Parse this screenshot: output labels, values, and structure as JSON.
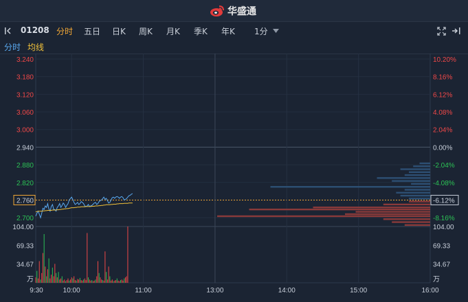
{
  "header": {
    "brand_name": "华盛通"
  },
  "toolbar": {
    "stock_code": "01208",
    "tabs": [
      {
        "label": "分时",
        "active": true
      },
      {
        "label": "五日",
        "active": false
      },
      {
        "label": "日K",
        "active": false
      },
      {
        "label": "周K",
        "active": false
      },
      {
        "label": "月K",
        "active": false
      },
      {
        "label": "季K",
        "active": false
      },
      {
        "label": "年K",
        "active": false
      }
    ],
    "interval_label": "1分",
    "icons": [
      "collapse-left-icon",
      "chevron-down-icon",
      "fullscreen-icon",
      "expand-right-icon"
    ]
  },
  "legend": {
    "timeshare_label": "分时",
    "avg_label": "均线"
  },
  "colors": {
    "background": "#1b2433",
    "up": "#f04848",
    "down": "#2cc255",
    "price_line": "#5aa9f0",
    "avg_line": "#f2c23a",
    "active_tab": "#f2a735",
    "bid_bars": "#8a3a3a",
    "ask_bars": "#2d4f73"
  },
  "chart_data": {
    "type": "line",
    "title": "",
    "y_ticks": [
      {
        "price": "3.240",
        "pct": "10.20%",
        "dir": "up"
      },
      {
        "price": "3.180",
        "pct": "8.16%",
        "dir": "up"
      },
      {
        "price": "3.120",
        "pct": "6.12%",
        "dir": "up"
      },
      {
        "price": "3.060",
        "pct": "4.08%",
        "dir": "up"
      },
      {
        "price": "3.000",
        "pct": "2.04%",
        "dir": "up"
      },
      {
        "price": "2.940",
        "pct": "0.00%",
        "dir": "flat"
      },
      {
        "price": "2.880",
        "pct": "-2.04%",
        "dir": "down"
      },
      {
        "price": "2.820",
        "pct": "-4.08%",
        "dir": "down"
      },
      {
        "price": "2.760",
        "pct": "-6.12%",
        "dir": "current"
      },
      {
        "price": "2.700",
        "pct": "-8.16%",
        "dir": "down"
      }
    ],
    "ylim": [
      2.67,
      3.24
    ],
    "prev_close": 2.94,
    "current_price": 2.76,
    "current_price_label": "2.760",
    "current_pct_label": "-6.12%",
    "x_ticks": [
      "9:30",
      "10:00",
      "11:00",
      "13:00",
      "14:00",
      "15:00",
      "16:00"
    ],
    "session_minutes": 330,
    "series": [
      {
        "name": "分时",
        "values": [
          2.705,
          2.715,
          2.722,
          2.712,
          2.7,
          2.715,
          2.732,
          2.728,
          2.74,
          2.735,
          2.748,
          2.73,
          2.722,
          2.738,
          2.745,
          2.728,
          2.728,
          2.722,
          2.735,
          2.74,
          2.748,
          2.735,
          2.742,
          2.75,
          2.745,
          2.735,
          2.742,
          2.748,
          2.76,
          2.765,
          2.77,
          2.762,
          2.752,
          2.745,
          2.748,
          2.752,
          2.745,
          2.748,
          2.755,
          2.752,
          2.748,
          2.74,
          2.738,
          2.74,
          2.745,
          2.738,
          2.74,
          2.742,
          2.746,
          2.75,
          2.752,
          2.745,
          2.748,
          2.755,
          2.758,
          2.76,
          2.765,
          2.77,
          2.762,
          2.766,
          2.758,
          2.75,
          2.752,
          2.76,
          2.768,
          2.77,
          2.766,
          2.77,
          2.772,
          2.77,
          2.766,
          2.77,
          2.772,
          2.768,
          2.76,
          2.762,
          2.765,
          2.77,
          2.775,
          2.776,
          2.78,
          2.782
        ]
      },
      {
        "name": "均线",
        "values": [
          2.72,
          2.721,
          2.722,
          2.722,
          2.722,
          2.722,
          2.723,
          2.723,
          2.724,
          2.724,
          2.725,
          2.725,
          2.725,
          2.725,
          2.726,
          2.726,
          2.726,
          2.726,
          2.727,
          2.727,
          2.728,
          2.728,
          2.729,
          2.729,
          2.73,
          2.73,
          2.731,
          2.731,
          2.732,
          2.733,
          2.734,
          2.734,
          2.734,
          2.735,
          2.735,
          2.736,
          2.736,
          2.736,
          2.737,
          2.737,
          2.737,
          2.737,
          2.738,
          2.738,
          2.738,
          2.738,
          2.738,
          2.739,
          2.739,
          2.739,
          2.74,
          2.74,
          2.74,
          2.741,
          2.741,
          2.742,
          2.742,
          2.743,
          2.743,
          2.744,
          2.744,
          2.744,
          2.744,
          2.745,
          2.745,
          2.746,
          2.746,
          2.746,
          2.747,
          2.747,
          2.748,
          2.748,
          2.748,
          2.748,
          2.749,
          2.749,
          2.749,
          2.749,
          2.75,
          2.75,
          2.75,
          2.75
        ]
      }
    ],
    "volume": {
      "ticks": [
        "104.00",
        "69.33",
        "34.67"
      ],
      "unit": "万",
      "max": 104,
      "bars": [
        {
          "v": 10,
          "up": true
        },
        {
          "v": 22,
          "up": false
        },
        {
          "v": 8,
          "up": true
        },
        {
          "v": 40,
          "up": true
        },
        {
          "v": 6,
          "up": false
        },
        {
          "v": 18,
          "up": true
        },
        {
          "v": 55,
          "up": true
        },
        {
          "v": 90,
          "up": false
        },
        {
          "v": 30,
          "up": true
        },
        {
          "v": 12,
          "up": false
        },
        {
          "v": 25,
          "up": true
        },
        {
          "v": 45,
          "up": false
        },
        {
          "v": 8,
          "up": true
        },
        {
          "v": 15,
          "up": true
        },
        {
          "v": 28,
          "up": false
        },
        {
          "v": 12,
          "up": true
        },
        {
          "v": 35,
          "up": true
        },
        {
          "v": 18,
          "up": false
        },
        {
          "v": 10,
          "up": true
        },
        {
          "v": 20,
          "up": false
        },
        {
          "v": 6,
          "up": true
        },
        {
          "v": 8,
          "up": true
        },
        {
          "v": 12,
          "up": false
        },
        {
          "v": 4,
          "up": true
        },
        {
          "v": 6,
          "up": true
        },
        {
          "v": 3,
          "up": false
        },
        {
          "v": 5,
          "up": true
        },
        {
          "v": 8,
          "up": true
        },
        {
          "v": 4,
          "up": false
        },
        {
          "v": 6,
          "up": true
        },
        {
          "v": 10,
          "up": true
        },
        {
          "v": 8,
          "up": false
        },
        {
          "v": 12,
          "up": true
        },
        {
          "v": 5,
          "up": true
        },
        {
          "v": 4,
          "up": false
        },
        {
          "v": 7,
          "up": true
        },
        {
          "v": 6,
          "up": true
        },
        {
          "v": 9,
          "up": false
        },
        {
          "v": 5,
          "up": true
        },
        {
          "v": 4,
          "up": true
        },
        {
          "v": 6,
          "up": false
        },
        {
          "v": 8,
          "up": true
        },
        {
          "v": 5,
          "up": true
        },
        {
          "v": 92,
          "up": true
        },
        {
          "v": 10,
          "up": false
        },
        {
          "v": 6,
          "up": true
        },
        {
          "v": 4,
          "up": true
        },
        {
          "v": 5,
          "up": false
        },
        {
          "v": 3,
          "up": true
        },
        {
          "v": 4,
          "up": true
        },
        {
          "v": 6,
          "up": false
        },
        {
          "v": 12,
          "up": true
        },
        {
          "v": 40,
          "up": true
        },
        {
          "v": 18,
          "up": false
        },
        {
          "v": 10,
          "up": true
        },
        {
          "v": 6,
          "up": true
        },
        {
          "v": 5,
          "up": false
        },
        {
          "v": 4,
          "up": true
        },
        {
          "v": 58,
          "up": true
        },
        {
          "v": 20,
          "up": false
        },
        {
          "v": 6,
          "up": true
        },
        {
          "v": 30,
          "up": true
        },
        {
          "v": 12,
          "up": false
        },
        {
          "v": 4,
          "up": true
        },
        {
          "v": 6,
          "up": true
        },
        {
          "v": 3,
          "up": false
        },
        {
          "v": 4,
          "up": true
        },
        {
          "v": 5,
          "up": true
        },
        {
          "v": 8,
          "up": false
        },
        {
          "v": 4,
          "up": true
        },
        {
          "v": 3,
          "up": true
        },
        {
          "v": 5,
          "up": false
        },
        {
          "v": 6,
          "up": true
        },
        {
          "v": 4,
          "up": true
        },
        {
          "v": 8,
          "up": false
        },
        {
          "v": 10,
          "up": true
        },
        {
          "v": 12,
          "up": true
        },
        {
          "v": 104,
          "up": true
        }
      ]
    },
    "order_book": {
      "ask_levels": [
        {
          "price": 2.885,
          "size": 0.05
        },
        {
          "price": 2.875,
          "size": 0.08
        },
        {
          "price": 2.865,
          "size": 0.14
        },
        {
          "price": 2.855,
          "size": 0.1
        },
        {
          "price": 2.845,
          "size": 0.12
        },
        {
          "price": 2.835,
          "size": 0.25
        },
        {
          "price": 2.825,
          "size": 0.18
        },
        {
          "price": 2.815,
          "size": 0.09
        },
        {
          "price": 2.805,
          "size": 0.75
        },
        {
          "price": 2.795,
          "size": 0.12
        },
        {
          "price": 2.785,
          "size": 0.16
        },
        {
          "price": 2.775,
          "size": 0.14
        },
        {
          "price": 2.765,
          "size": 0.1
        }
      ],
      "bid_levels": [
        {
          "price": 2.755,
          "size": 0.1
        },
        {
          "price": 2.745,
          "size": 0.22
        },
        {
          "price": 2.735,
          "size": 0.55
        },
        {
          "price": 2.728,
          "size": 0.85
        },
        {
          "price": 2.72,
          "size": 0.35
        },
        {
          "price": 2.712,
          "size": 0.4
        },
        {
          "price": 2.705,
          "size": 1.0
        },
        {
          "price": 2.695,
          "size": 0.22
        },
        {
          "price": 2.685,
          "size": 0.18
        },
        {
          "price": 2.675,
          "size": 0.12
        }
      ]
    }
  }
}
